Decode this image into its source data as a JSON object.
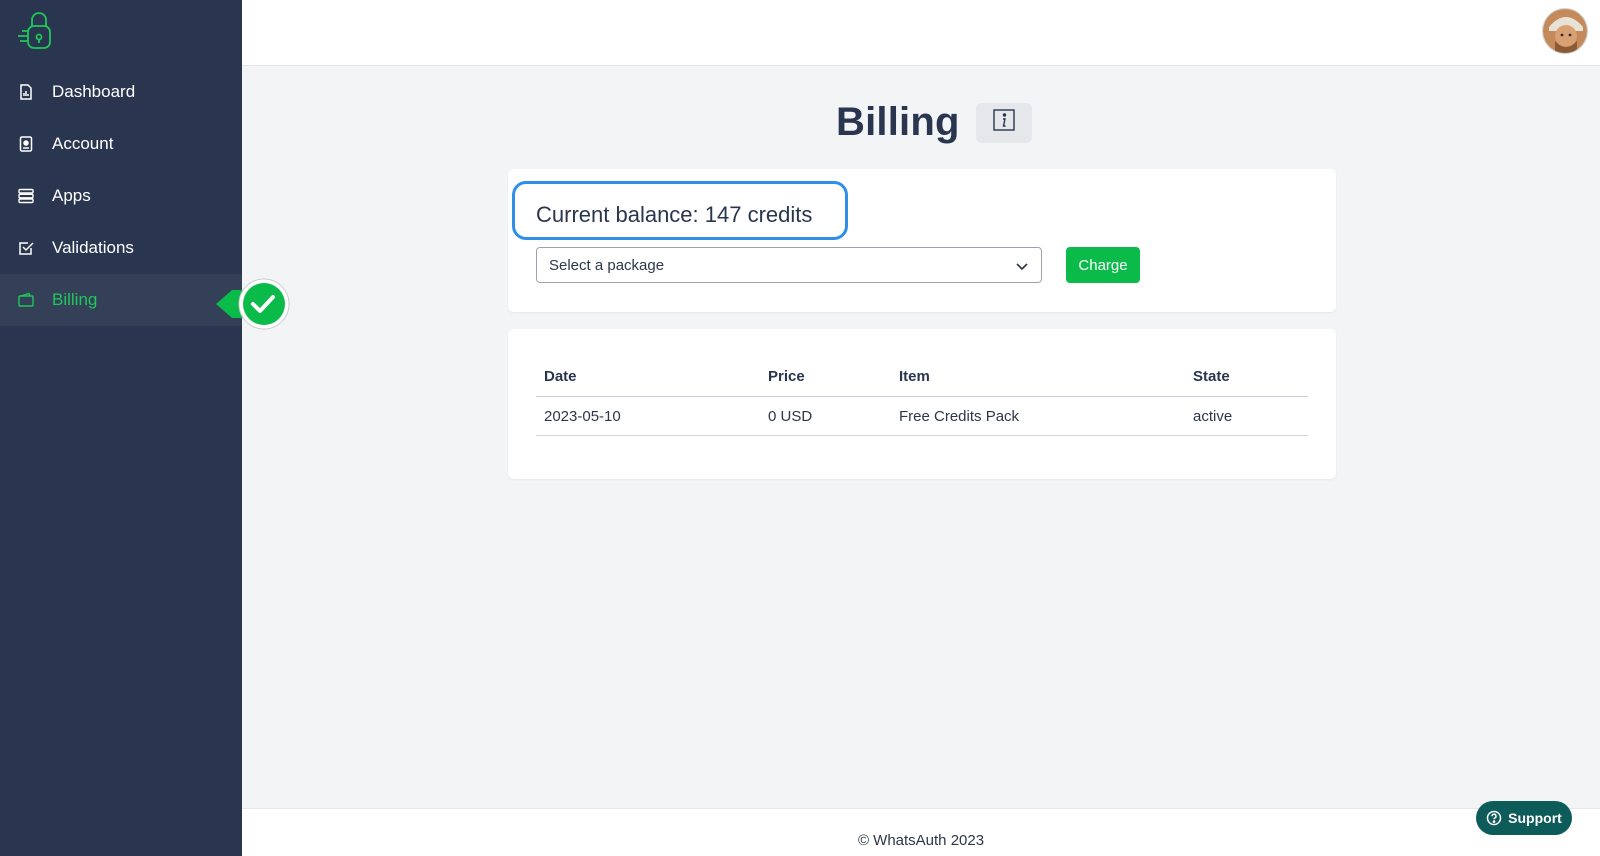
{
  "sidebar": {
    "logo_icon": "whatsauth-lock-logo",
    "items": [
      {
        "label": "Dashboard",
        "icon": "document-chart-icon"
      },
      {
        "label": "Account",
        "icon": "id-card-icon"
      },
      {
        "label": "Apps",
        "icon": "server-stack-icon"
      },
      {
        "label": "Validations",
        "icon": "checkbox-icon"
      },
      {
        "label": "Billing",
        "icon": "wallet-icon",
        "active": true
      }
    ]
  },
  "header": {
    "avatar": "user-avatar"
  },
  "page": {
    "title": "Billing",
    "info_icon": "info-icon"
  },
  "balance": {
    "text": "Current balance: 147 credits"
  },
  "package_select": {
    "value": "Select a package"
  },
  "charge_button": {
    "label": "Charge"
  },
  "history": {
    "columns": [
      "Date",
      "Price",
      "Item",
      "State"
    ],
    "rows": [
      [
        "2023-05-10",
        "0 USD",
        "Free Credits Pack",
        "active"
      ]
    ]
  },
  "footer": {
    "text": "© WhatsAuth 2023"
  },
  "support": {
    "label": "Support"
  },
  "colors": {
    "sidebar_bg": "#2a3650",
    "accent_green": "#0bbb4a",
    "highlight_blue": "#2e8fe8",
    "support_bg": "#0e5c5a"
  }
}
